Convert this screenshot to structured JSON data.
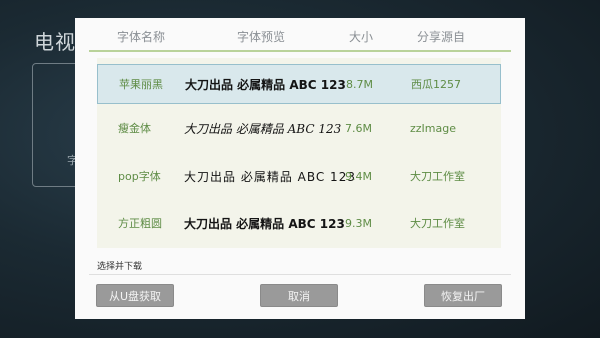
{
  "background": {
    "title": "电视",
    "card_text": "字"
  },
  "header": {
    "col_name": "字体名称",
    "col_preview": "字体预览",
    "col_size": "大小",
    "col_source": "分享源自"
  },
  "fonts": [
    {
      "name": "苹果丽黑",
      "preview": "大刀出品 必属精品 ABC 123",
      "size": "8.7M",
      "source": "西瓜1257",
      "selected": true
    },
    {
      "name": "瘦金体",
      "preview": "大刀出品 必属精品 ABC 123",
      "size": "7.6M",
      "source": "zzImage",
      "selected": false
    },
    {
      "name": "pop字体",
      "preview": "大刀出品 必属精品 ABC 123",
      "size": "9.4M",
      "source": "大刀工作室",
      "selected": false
    },
    {
      "name": "方正粗圆",
      "preview": "大刀出品 必属精品 ABC 123",
      "size": "9.3M",
      "source": "大刀工作室",
      "selected": false
    }
  ],
  "hint": "选择并下载",
  "buttons": {
    "from_usb": "从U盘获取",
    "cancel": "取消",
    "restore": "恢复出厂"
  },
  "colors": {
    "accent_line": "#b9d29a",
    "row_text": "#5e8c45",
    "selected_bg": "#d9e8ec",
    "button_bg": "#9a9a9a"
  }
}
